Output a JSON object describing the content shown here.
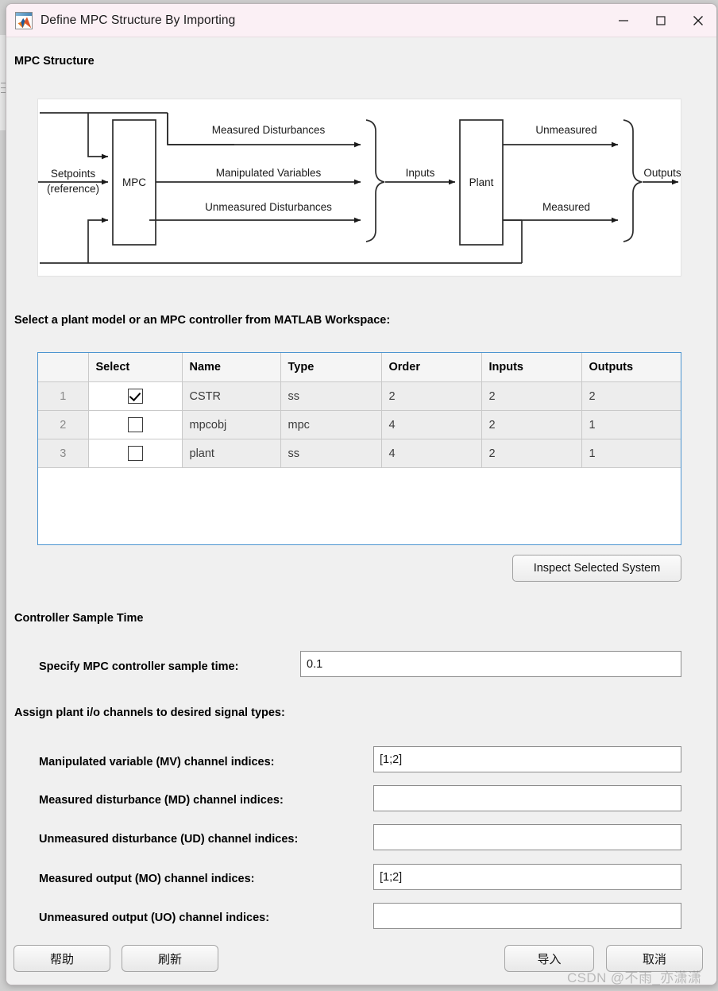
{
  "window": {
    "title": "Define MPC Structure By Importing",
    "icon": "matlab-icon",
    "minimize": "minimize-icon",
    "maximize": "maximize-icon",
    "close": "close-icon"
  },
  "sections": {
    "mpc_structure": "MPC Structure",
    "select_model": "Select a plant model or an MPC controller from MATLAB Workspace:",
    "controller_sample_time": "Controller Sample Time",
    "assign_channels": "Assign plant i/o channels to desired signal types:"
  },
  "diagram": {
    "blocks": {
      "mpc": "MPC",
      "plant": "Plant"
    },
    "labels": {
      "setpoints_line1": "Setpoints",
      "setpoints_line2": "(reference)",
      "measured_disturbances": "Measured Disturbances",
      "manipulated_variables": "Manipulated Variables",
      "unmeasured_disturbances": "Unmeasured Disturbances",
      "inputs": "Inputs",
      "unmeasured": "Unmeasured",
      "measured": "Measured",
      "outputs": "Outputs"
    }
  },
  "table": {
    "columns": [
      "",
      "Select",
      "Name",
      "Type",
      "Order",
      "Inputs",
      "Outputs"
    ],
    "rows": [
      {
        "num": "1",
        "selected": true,
        "name": "CSTR",
        "type": "ss",
        "order": "2",
        "inputs": "2",
        "outputs": "2"
      },
      {
        "num": "2",
        "selected": false,
        "name": "mpcobj",
        "type": "mpc",
        "order": "4",
        "inputs": "2",
        "outputs": "1"
      },
      {
        "num": "3",
        "selected": false,
        "name": "plant",
        "type": "ss",
        "order": "4",
        "inputs": "2",
        "outputs": "1"
      }
    ]
  },
  "buttons": {
    "inspect": "Inspect Selected System",
    "help": "帮助",
    "refresh": "刷新",
    "import": "导入",
    "cancel": "取消"
  },
  "fields": {
    "sample_time": {
      "label": "Specify MPC controller sample time:",
      "value": "0.1"
    },
    "mv": {
      "label": "Manipulated variable (MV) channel indices:",
      "value": "[1;2]"
    },
    "md": {
      "label": "Measured disturbance (MD) channel indices:",
      "value": ""
    },
    "ud": {
      "label": "Unmeasured disturbance (UD) channel indices:",
      "value": ""
    },
    "mo": {
      "label": "Measured output (MO) channel indices:",
      "value": "[1;2]"
    },
    "uo": {
      "label": "Unmeasured output (UO) channel indices:",
      "value": ""
    }
  },
  "watermark": "CSDN @不雨_亦潇潇",
  "colors": {
    "titlebar": "#fbf0f5",
    "window_bg": "#f0f0f0",
    "table_border": "#4b94d0",
    "row_bg": "#ededed",
    "header_bg": "#f5f5f5"
  }
}
